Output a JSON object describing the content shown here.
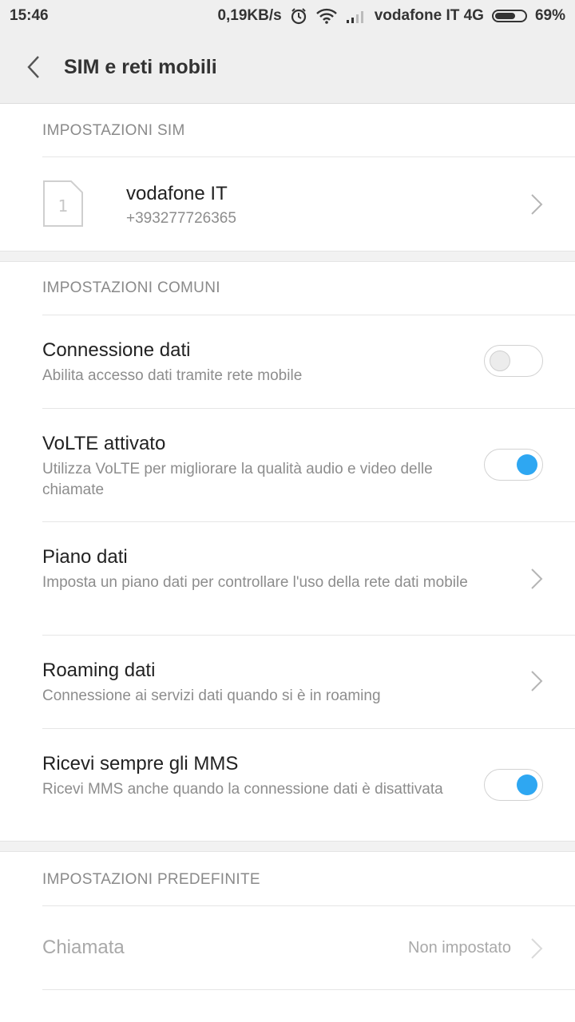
{
  "status_bar": {
    "time": "15:46",
    "speed": "0,19KB/s",
    "carrier": "vodafone IT 4G",
    "battery_percent": "69%",
    "battery_level": 0.69,
    "icons": [
      "alarm-icon",
      "wifi-icon",
      "signal-icon",
      "battery-icon"
    ]
  },
  "header": {
    "title": "SIM e reti mobili",
    "back_icon": "back-chevron-icon"
  },
  "sim_settings": {
    "header": "IMPOSTAZIONI SIM",
    "sim": {
      "slot": "1",
      "name": "vodafone IT",
      "number": "+393277726365"
    }
  },
  "common_settings": {
    "header": "IMPOSTAZIONI COMUNI",
    "items": [
      {
        "title": "Connessione dati",
        "subtitle": "Abilita accesso dati tramite rete mobile",
        "control": "toggle",
        "enabled": false
      },
      {
        "title": "VoLTE attivato",
        "subtitle": "Utilizza VoLTE per migliorare la qualità audio e video delle chiamate",
        "control": "toggle",
        "enabled": true
      },
      {
        "title": "Piano dati",
        "subtitle": "Imposta un piano dati per controllare l'uso della rete dati mobile",
        "control": "chevron"
      },
      {
        "title": "Roaming dati",
        "subtitle": "Connessione ai servizi dati quando si è in roaming",
        "control": "chevron"
      },
      {
        "title": "Ricevi sempre gli MMS",
        "subtitle": "Ricevi MMS anche quando la connessione dati è disattivata",
        "control": "toggle",
        "enabled": true
      }
    ]
  },
  "default_settings": {
    "header": "IMPOSTAZIONI PREDEFINITE",
    "items": [
      {
        "title": "Chiamata",
        "value": "Non impostato",
        "control": "chevron",
        "disabled": true
      }
    ]
  },
  "colors": {
    "accent": "#2ea7f2",
    "toolbar_bg": "#efefef"
  }
}
